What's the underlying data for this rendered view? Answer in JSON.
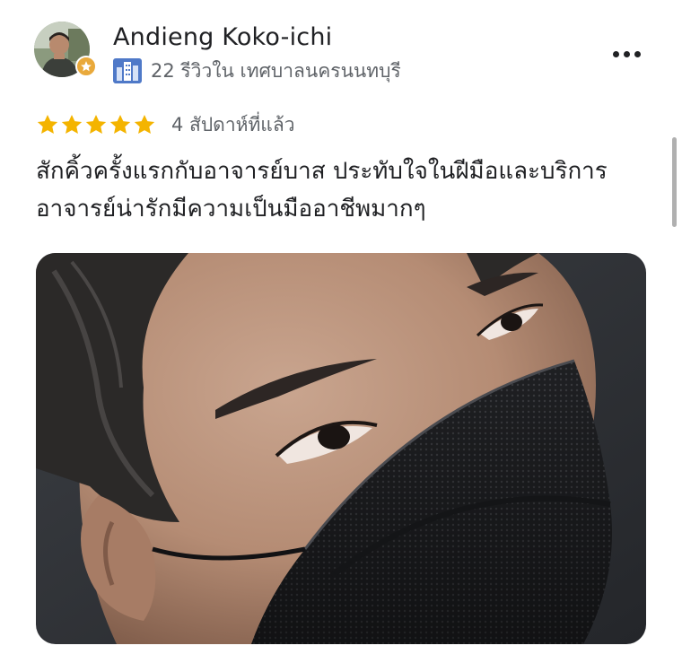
{
  "reviewer": {
    "name": "Andieng Koko-ichi",
    "reviews_label": "22 รีวิวใน เทศบาลนครนนทบุรี",
    "avatar_icon": "avatar-photo",
    "badge_icon": "local-guide-star-icon",
    "location_icon": "city-buildings-icon"
  },
  "review": {
    "rating": 5,
    "max_rating": 5,
    "date": "4 สัปดาห์ที่แล้ว",
    "text_lines": [
      "สักคิ้วครั้งแรกกับอาจารย์บาส ประทับใจในฝีมือและบริการ",
      "อาจารย์น่ารักมีความเป็นมืออาชีพมากๆ"
    ]
  },
  "menu": {
    "icon": "more-options-icon"
  },
  "photo": {
    "subject": "close-up of eyebrow and eye with black face mask"
  },
  "colors": {
    "star": "#f4b400",
    "text": "#202124",
    "meta": "#5f6368",
    "badge": "#e9a93b"
  }
}
